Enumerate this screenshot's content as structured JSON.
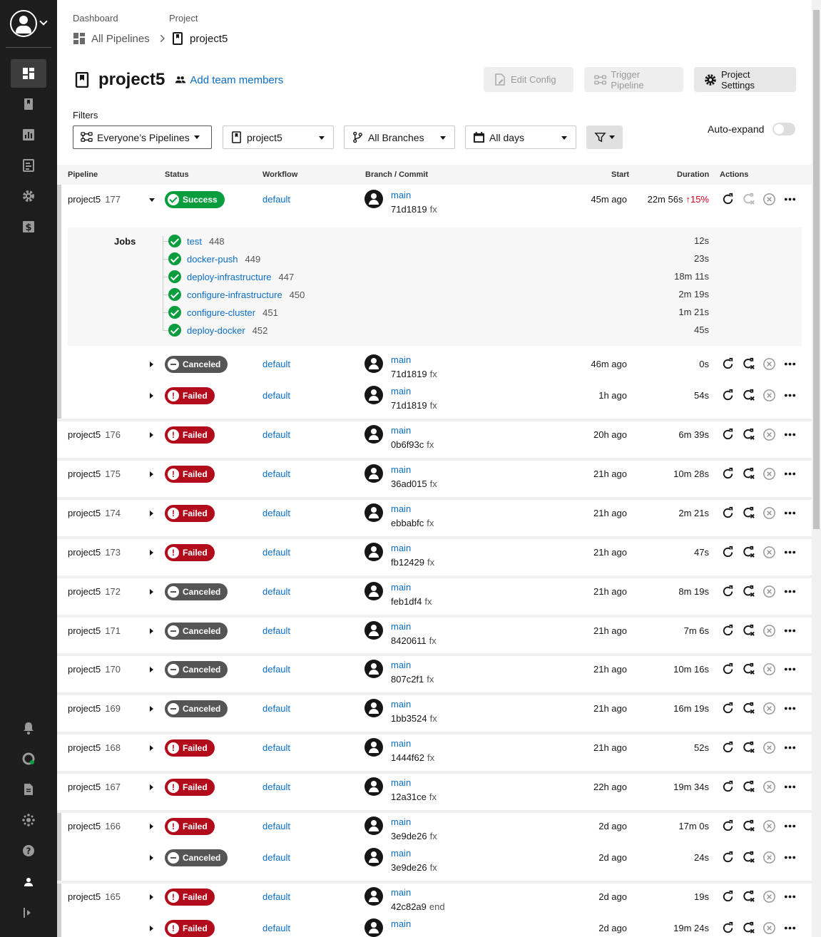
{
  "breadcrumb": {
    "dashboard_label": "Dashboard",
    "dashboard_value": "All Pipelines",
    "project_label": "Project",
    "project_value": "project5"
  },
  "header": {
    "title": "project5",
    "add_team": "Add team members",
    "edit_config": "Edit Config",
    "trigger_pipeline": "Trigger Pipeline",
    "project_settings": "Project Settings"
  },
  "filters": {
    "label": "Filters",
    "pipelines": "Everyone’s Pipelines",
    "project": "project5",
    "branches": "All Branches",
    "days": "All days",
    "auto_expand": "Auto-expand",
    "auto_expand_on": false
  },
  "table": {
    "headers": [
      "Pipeline",
      "Status",
      "Workflow",
      "Branch / Commit",
      "Start",
      "Duration",
      "Actions"
    ],
    "jobs_label": "Jobs",
    "pipelines": [
      {
        "name": "project5",
        "num": "177",
        "status": "Success",
        "workflow": "default",
        "branch": "main",
        "commit": "71d1819",
        "msg": "fx",
        "start": "45m ago",
        "duration": "22m 56s",
        "trend": "15%"
      },
      {
        "name": "",
        "num": "",
        "status": "Canceled",
        "workflow": "default",
        "branch": "main",
        "commit": "71d1819",
        "msg": "fx",
        "start": "46m ago",
        "duration": "0s"
      },
      {
        "name": "",
        "num": "",
        "status": "Failed",
        "workflow": "default",
        "branch": "main",
        "commit": "71d1819",
        "msg": "fx",
        "start": "1h ago",
        "duration": "54s"
      },
      {
        "name": "project5",
        "num": "176",
        "status": "Failed",
        "workflow": "default",
        "branch": "main",
        "commit": "0b6f93c",
        "msg": "fx",
        "start": "20h ago",
        "duration": "6m 39s"
      },
      {
        "name": "project5",
        "num": "175",
        "status": "Failed",
        "workflow": "default",
        "branch": "main",
        "commit": "36ad015",
        "msg": "fx",
        "start": "21h ago",
        "duration": "10m 28s"
      },
      {
        "name": "project5",
        "num": "174",
        "status": "Failed",
        "workflow": "default",
        "branch": "main",
        "commit": "ebbabfc",
        "msg": "fx",
        "start": "21h ago",
        "duration": "2m 21s"
      },
      {
        "name": "project5",
        "num": "173",
        "status": "Failed",
        "workflow": "default",
        "branch": "main",
        "commit": "fb12429",
        "msg": "fx",
        "start": "21h ago",
        "duration": "47s"
      },
      {
        "name": "project5",
        "num": "172",
        "status": "Canceled",
        "workflow": "default",
        "branch": "main",
        "commit": "feb1df4",
        "msg": "fx",
        "start": "21h ago",
        "duration": "8m 19s"
      },
      {
        "name": "project5",
        "num": "171",
        "status": "Canceled",
        "workflow": "default",
        "branch": "main",
        "commit": "8420611",
        "msg": "fx",
        "start": "21h ago",
        "duration": "7m 6s"
      },
      {
        "name": "project5",
        "num": "170",
        "status": "Canceled",
        "workflow": "default",
        "branch": "main",
        "commit": "807c2f1",
        "msg": "fx",
        "start": "21h ago",
        "duration": "10m 16s"
      },
      {
        "name": "project5",
        "num": "169",
        "status": "Canceled",
        "workflow": "default",
        "branch": "main",
        "commit": "1bb3524",
        "msg": "fx",
        "start": "21h ago",
        "duration": "16m 19s"
      },
      {
        "name": "project5",
        "num": "168",
        "status": "Failed",
        "workflow": "default",
        "branch": "main",
        "commit": "1444f62",
        "msg": "fx",
        "start": "21h ago",
        "duration": "52s"
      },
      {
        "name": "project5",
        "num": "167",
        "status": "Failed",
        "workflow": "default",
        "branch": "main",
        "commit": "12a31ce",
        "msg": "fx",
        "start": "22h ago",
        "duration": "19m 34s"
      },
      {
        "name": "project5",
        "num": "166",
        "status": "Failed",
        "workflow": "default",
        "branch": "main",
        "commit": "3e9de26",
        "msg": "fx",
        "start": "2d ago",
        "duration": "17m 0s"
      },
      {
        "name": "",
        "num": "",
        "status": "Canceled",
        "workflow": "default",
        "branch": "main",
        "commit": "3e9de26",
        "msg": "fx",
        "start": "2d ago",
        "duration": "24s"
      },
      {
        "name": "project5",
        "num": "165",
        "status": "Failed",
        "workflow": "default",
        "branch": "main",
        "commit": "42c82a9",
        "msg": "end",
        "start": "2d ago",
        "duration": "19s"
      },
      {
        "name": "",
        "num": "",
        "status": "Failed",
        "workflow": "default",
        "branch": "main",
        "commit": "",
        "msg": "",
        "start": "2d ago",
        "duration": "19m 24s"
      }
    ],
    "jobs": [
      {
        "name": "test",
        "num": "448",
        "duration": "12s"
      },
      {
        "name": "docker-push",
        "num": "449",
        "duration": "23s"
      },
      {
        "name": "deploy-infrastructure",
        "num": "447",
        "duration": "18m 11s"
      },
      {
        "name": "configure-infrastructure",
        "num": "450",
        "duration": "2m 19s"
      },
      {
        "name": "configure-cluster",
        "num": "451",
        "duration": "1m 21s"
      },
      {
        "name": "deploy-docker",
        "num": "452",
        "duration": "45s"
      }
    ]
  },
  "colors": {
    "success": "#0a9d3e",
    "failed": "#b20b1c",
    "canceled": "#555555",
    "link": "#0b6ec5",
    "sidebar": "#1d1d1d"
  }
}
